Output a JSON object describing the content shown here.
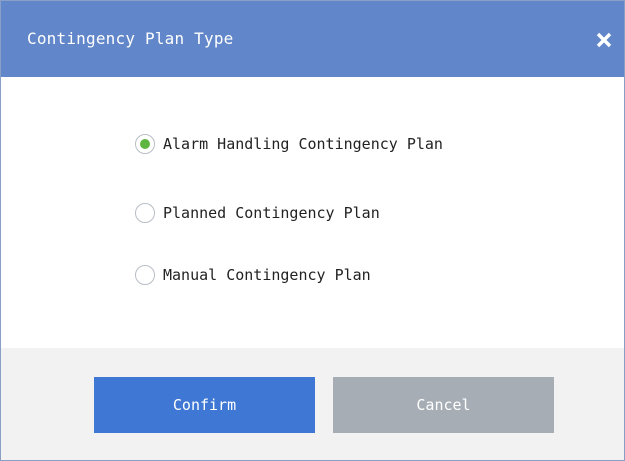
{
  "dialog": {
    "title": "Contingency Plan Type",
    "close_icon": "close-icon"
  },
  "options": [
    {
      "label": "Alarm Handling Contingency Plan",
      "checked": true
    },
    {
      "label": "Planned Contingency Plan",
      "checked": false
    },
    {
      "label": "Manual Contingency Plan",
      "checked": false
    }
  ],
  "buttons": {
    "confirm_label": "Confirm",
    "cancel_label": "Cancel"
  },
  "colors": {
    "titlebar": "#6186c9",
    "confirm": "#3f78d4",
    "cancel": "#a6adb5",
    "radio_selected": "#5fb541",
    "footer": "#f2f2f2"
  }
}
